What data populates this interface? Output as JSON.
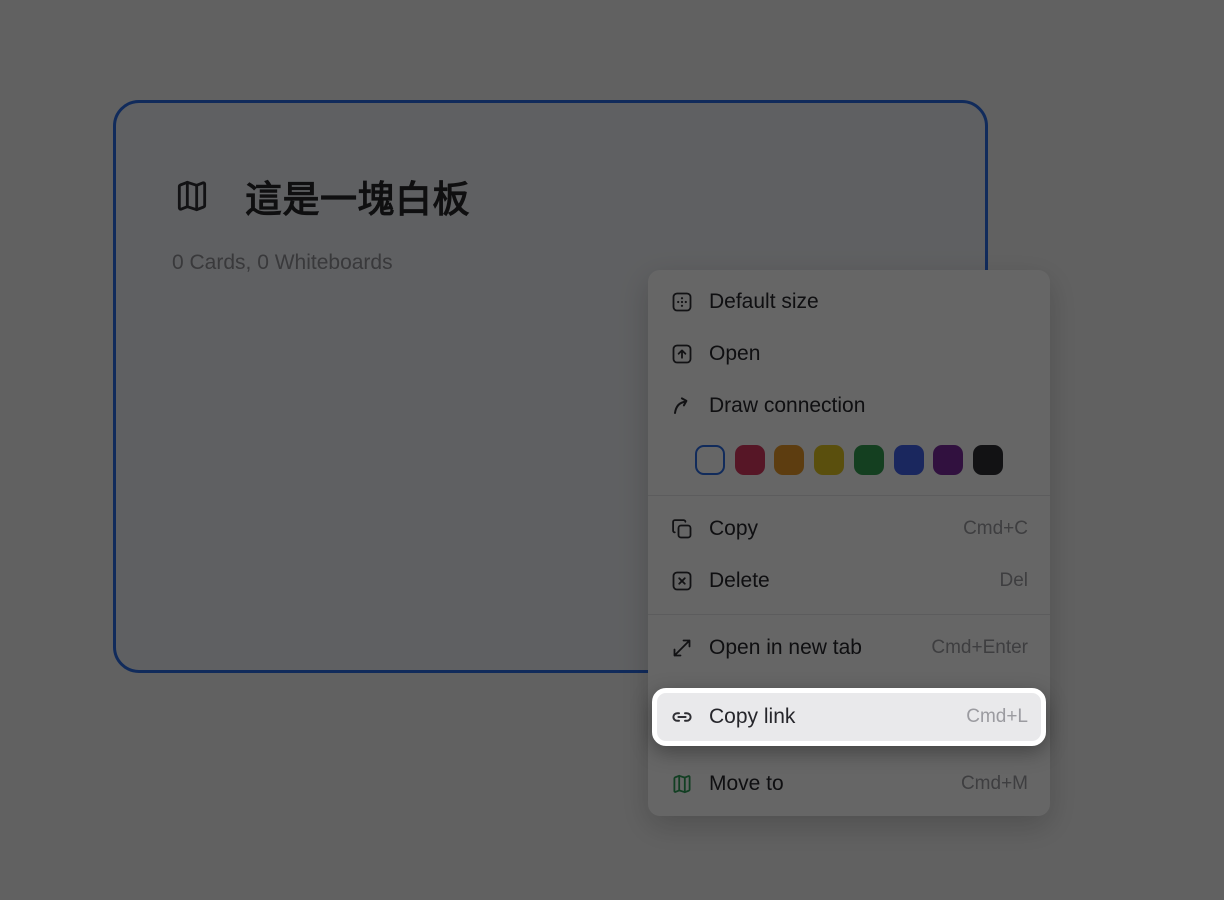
{
  "colors": {
    "canvas": "#f3f3f3",
    "card_bg": "#eef0f4",
    "accent": "#2b6be4",
    "menu_bg": "#ffffff",
    "label": "#26262b",
    "shortcut": "#9b9ba0",
    "hover_bg": "#e9e9eb",
    "separator": "#e7e7e9",
    "subtitle": "#8e8e94",
    "icon": "#2e2e33",
    "move_to_icon": "#2f9e57",
    "overlay": "rgba(0,0,0,0.6)"
  },
  "card": {
    "title": "這是一塊白板",
    "subtitle": "0 Cards, 0 Whiteboards"
  },
  "context_menu": {
    "items": [
      {
        "label": "Default size"
      },
      {
        "label": "Open"
      },
      {
        "label": "Draw connection"
      },
      {
        "label": "Copy",
        "shortcut": "Cmd+C"
      },
      {
        "label": "Delete",
        "shortcut": "Del"
      },
      {
        "label": "Open in new tab",
        "shortcut": "Cmd+Enter"
      },
      {
        "label": "Copy link",
        "shortcut": "Cmd+L",
        "highlighted": true
      },
      {
        "label": "Move to",
        "shortcut": "Cmd+M"
      }
    ],
    "swatches": [
      {
        "name": "white",
        "color": "#ffffff",
        "selected": true,
        "ring": "#2b6be4"
      },
      {
        "name": "red",
        "color": "#d7375f"
      },
      {
        "name": "orange",
        "color": "#e89a28"
      },
      {
        "name": "yellow",
        "color": "#e2c522"
      },
      {
        "name": "green",
        "color": "#339e52"
      },
      {
        "name": "blue",
        "color": "#4263eb"
      },
      {
        "name": "purple",
        "color": "#7b2c9e"
      },
      {
        "name": "black",
        "color": "#2e2e33"
      }
    ]
  }
}
